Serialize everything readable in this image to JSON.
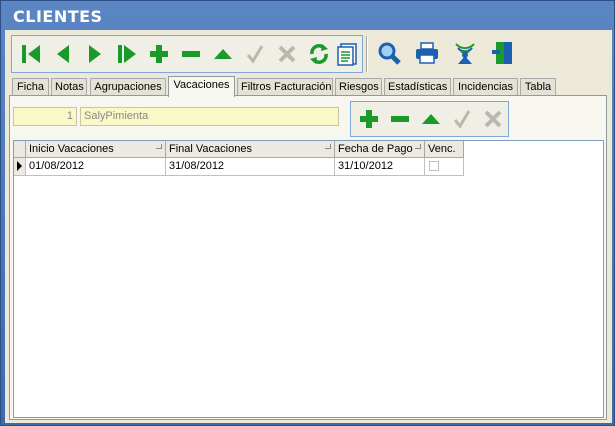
{
  "window": {
    "title": "CLIENTES"
  },
  "toolbar": {
    "buttons": [
      "first-record",
      "previous-record",
      "next-record",
      "last-record",
      "add",
      "delete",
      "up",
      "confirm",
      "cancel",
      "refresh",
      "list",
      "search",
      "print",
      "broadcast",
      "exit"
    ]
  },
  "tabs": [
    {
      "label": "Ficha",
      "active": false
    },
    {
      "label": "Notas",
      "active": false
    },
    {
      "label": "Agrupaciones",
      "active": false
    },
    {
      "label": "Vacaciones",
      "active": true
    },
    {
      "label": "Filtros Facturación",
      "active": false
    },
    {
      "label": "Riesgos",
      "active": false
    },
    {
      "label": "Estadísticas",
      "active": false
    },
    {
      "label": "Incidencias",
      "active": false
    },
    {
      "label": "Tabla",
      "active": false
    }
  ],
  "client": {
    "id": "1",
    "name": "SalyPimienta"
  },
  "grid": {
    "columns": [
      "Inicio Vacaciones",
      "Final Vacaciones",
      "Fecha de Pago",
      "Venc."
    ],
    "rows": [
      {
        "inicio": "01/08/2012",
        "final": "31/08/2012",
        "pago": "31/10/2012",
        "venc": false
      }
    ]
  },
  "colors": {
    "green": "#1a9a2a",
    "blue": "#1d5fb0",
    "disabled": "#b8b8b0"
  }
}
